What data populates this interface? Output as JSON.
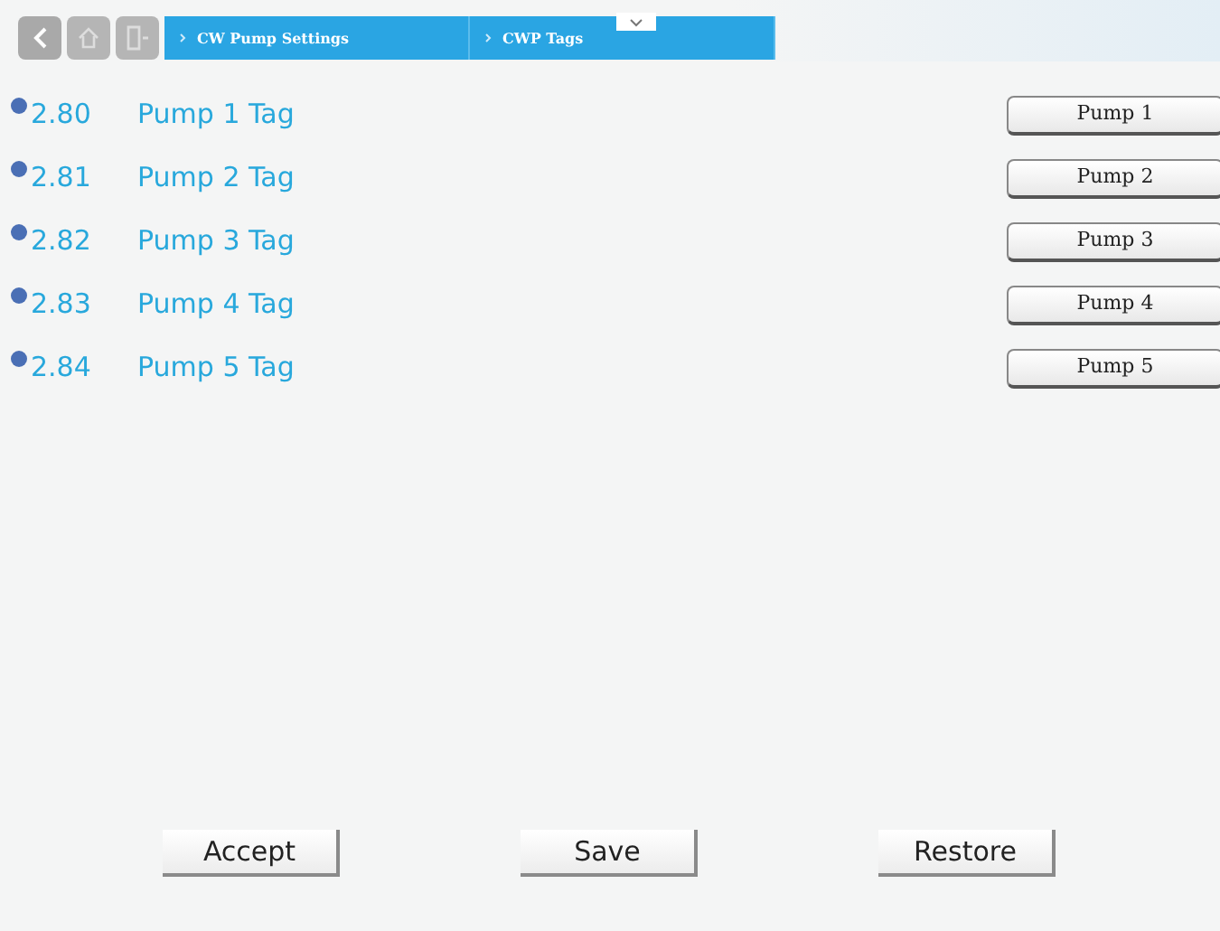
{
  "breadcrumb": [
    {
      "label": "CW Pump Settings"
    },
    {
      "label": "CWP Tags"
    }
  ],
  "rows": [
    {
      "code": "2.80",
      "label": "Pump 1 Tag",
      "button": "Pump 1"
    },
    {
      "code": "2.81",
      "label": "Pump 2 Tag",
      "button": "Pump 2"
    },
    {
      "code": "2.82",
      "label": "Pump 3 Tag",
      "button": "Pump 3"
    },
    {
      "code": "2.83",
      "label": "Pump 4 Tag",
      "button": "Pump 4"
    },
    {
      "code": "2.84",
      "label": "Pump 5 Tag",
      "button": "Pump 5"
    }
  ],
  "actions": [
    "Accept",
    "Save",
    "Restore"
  ]
}
